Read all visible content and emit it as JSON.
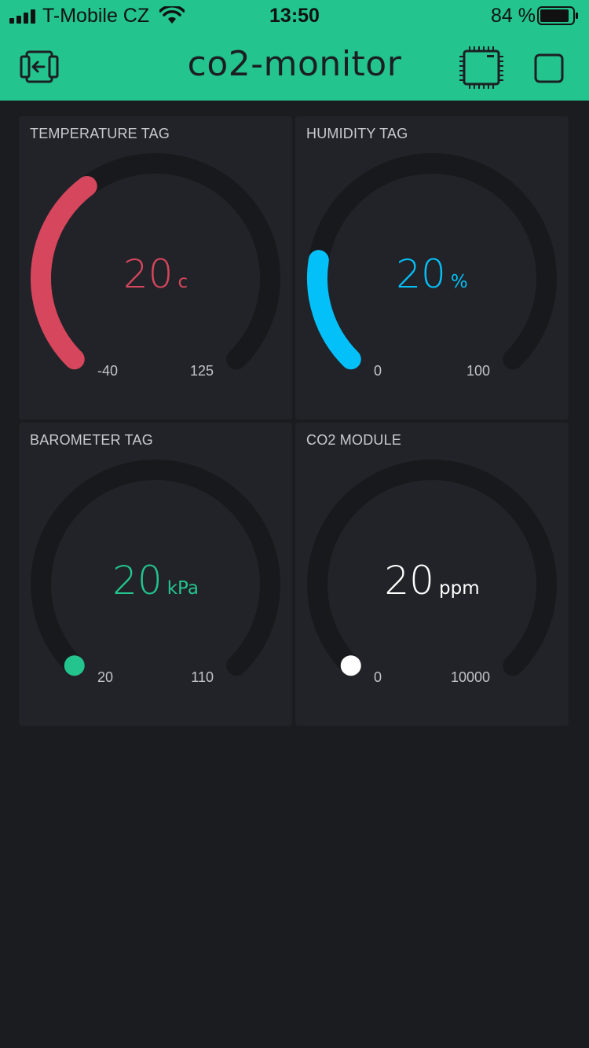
{
  "status_bar": {
    "carrier": "T-Mobile CZ",
    "time": "13:50",
    "battery": "84 %"
  },
  "header": {
    "title": "co2-monitor"
  },
  "widgets": [
    {
      "label": "TEMPERATURE TAG",
      "value": "20",
      "unit": "c",
      "min": "-40",
      "max": "125",
      "fraction": 0.364,
      "color": "#d6465d"
    },
    {
      "label": "HUMIDITY TAG",
      "value": "20",
      "unit": "%",
      "min": "0",
      "max": "100",
      "fraction": 0.2,
      "color": "#04c0f8"
    },
    {
      "label": "BAROMETER TAG",
      "value": "20",
      "unit": "kPa",
      "min": "20",
      "max": "110",
      "fraction": 0.0,
      "color": "#23c48e"
    },
    {
      "label": "CO2 MODULE",
      "value": "20",
      "unit": "ppm",
      "min": "0",
      "max": "10000",
      "fraction": 0.002,
      "color": "#ffffff"
    }
  ],
  "colors": {
    "accent": "#23c48e",
    "background": "#1b1c20",
    "panel": "#222328",
    "track": "#18191c"
  },
  "icons": [
    "signal-icon",
    "wifi-icon",
    "battery-icon",
    "back-icon",
    "device-icon",
    "play-icon"
  ]
}
